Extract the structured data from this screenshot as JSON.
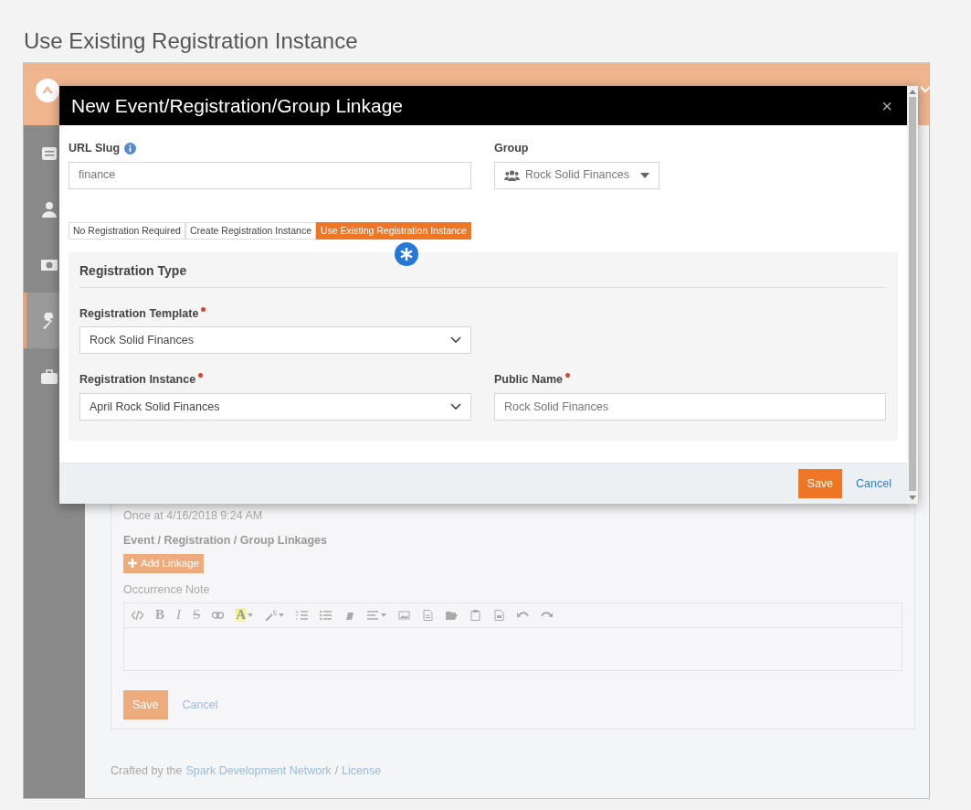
{
  "page_title": "Use Existing Registration Instance",
  "app": {
    "sidebar": {
      "items": [
        {
          "kind": "list",
          "selected": false
        },
        {
          "kind": "person",
          "selected": false
        },
        {
          "kind": "money",
          "selected": false
        },
        {
          "kind": "wrench",
          "selected": true
        },
        {
          "kind": "briefcase",
          "selected": false
        }
      ]
    },
    "content": {
      "schedule_text": "Once at 4/16/2018 9:24 AM",
      "linkages_label": "Event / Registration / Group Linkages",
      "add_linkage_button": "Add Linkage",
      "occurrence_note_label": "Occurrence Note",
      "editor_toolbar": [
        {
          "kind": "code",
          "dropdown": false
        },
        {
          "kind": "bold",
          "label": "B",
          "dropdown": false
        },
        {
          "kind": "italic",
          "label": "I",
          "dropdown": false
        },
        {
          "kind": "strike",
          "label": "S",
          "dropdown": false
        },
        {
          "kind": "link",
          "dropdown": false
        },
        {
          "kind": "highlight",
          "label": "A",
          "dropdown": true
        },
        {
          "kind": "wand",
          "dropdown": true
        },
        {
          "kind": "ol",
          "dropdown": false
        },
        {
          "kind": "ul",
          "dropdown": false
        },
        {
          "kind": "eraser",
          "dropdown": false
        },
        {
          "kind": "align",
          "dropdown": true
        },
        {
          "kind": "image",
          "dropdown": false
        },
        {
          "kind": "file",
          "dropdown": false
        },
        {
          "kind": "folder",
          "dropdown": false
        },
        {
          "kind": "clipboard",
          "dropdown": false
        },
        {
          "kind": "doc",
          "dropdown": false
        },
        {
          "kind": "undo",
          "dropdown": false
        },
        {
          "kind": "redo",
          "dropdown": false
        }
      ],
      "save_button": "Save",
      "cancel_link": "Cancel"
    },
    "footer": {
      "prefix": "Crafted by the",
      "link": "Spark Development Network",
      "separator": "/",
      "license_link": "License"
    }
  },
  "modal": {
    "title": "New Event/Registration/Group Linkage",
    "close": "×",
    "url_slug": {
      "label": "URL Slug",
      "value": "finance"
    },
    "group": {
      "label": "Group",
      "value": "Rock Solid Finances"
    },
    "registration_options": [
      {
        "label": "No Registration Required",
        "selected": false
      },
      {
        "label": "Create Registration Instance",
        "selected": false
      },
      {
        "label": "Use Existing Registration Instance",
        "selected": true
      }
    ],
    "section_title": "Registration Type",
    "field_rows": [
      [
        {
          "kind": "select",
          "label": "Registration Template",
          "required": true,
          "value": "Rock Solid Finances"
        }
      ],
      [
        {
          "kind": "select",
          "label": "Registration Instance",
          "required": true,
          "value": "April Rock Solid Finances"
        },
        {
          "kind": "text",
          "label": "Public Name",
          "required": true,
          "value": "Rock Solid Finances"
        }
      ]
    ],
    "save_button": "Save",
    "cancel_link": "Cancel"
  }
}
